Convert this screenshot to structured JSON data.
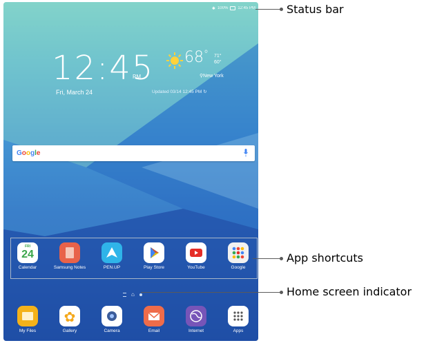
{
  "status_bar": {
    "battery": "100%",
    "time": "12:45 PM"
  },
  "clock": {
    "time": "12:45",
    "ampm": "PM",
    "date": "Fri, March 24"
  },
  "weather": {
    "temp": "68",
    "unit": "°",
    "high": "71°",
    "low": "60°",
    "location": "New York",
    "updated": "Updated 03/14 12:45 PM"
  },
  "search": {
    "logo": "Google"
  },
  "apps": [
    {
      "label": "Calendar",
      "day": "FRI",
      "date": "24"
    },
    {
      "label": "Samsung Notes"
    },
    {
      "label": "PEN.UP"
    },
    {
      "label": "Play Store"
    },
    {
      "label": "YouTube"
    },
    {
      "label": "Google"
    }
  ],
  "dock": [
    {
      "label": "My Files"
    },
    {
      "label": "Gallery"
    },
    {
      "label": "Camera"
    },
    {
      "label": "Email"
    },
    {
      "label": "Internet"
    },
    {
      "label": "Apps"
    }
  ],
  "annotations": {
    "status_bar": "Status bar",
    "app_shortcuts": "App shortcuts",
    "home_indicator": "Home screen indicator"
  },
  "colors": {
    "calendar_green": "#3aa54a",
    "notes_orange": "#e8624a",
    "penup_blue": "#2fb4e9",
    "youtube_red": "#e52d27",
    "myfiles_yellow": "#f4b21a",
    "internet_purple": "#7755b8"
  }
}
